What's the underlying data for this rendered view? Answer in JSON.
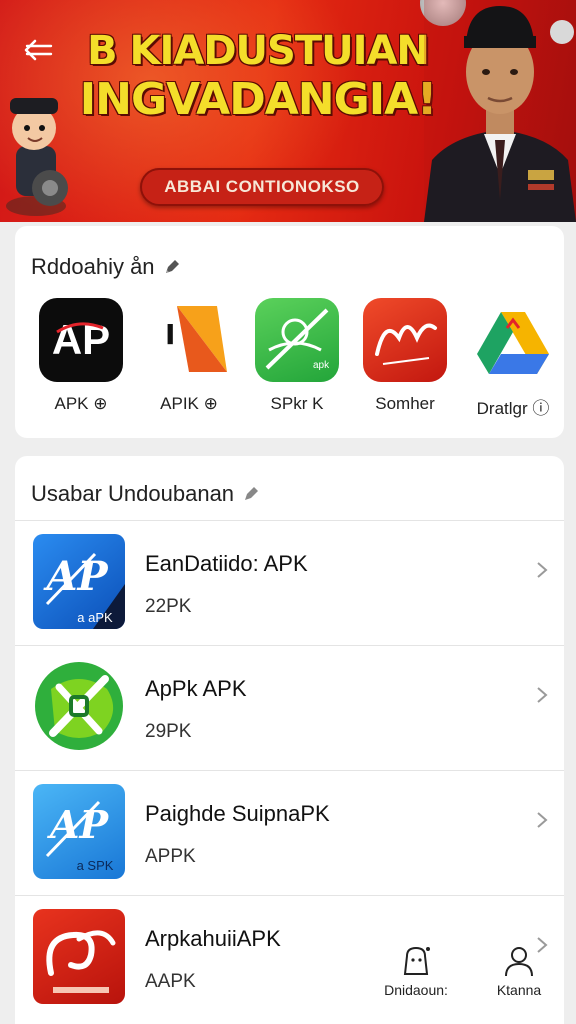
{
  "banner": {
    "headline_line1": "B KIADUSTUIAN",
    "headline_line2": "INGVADANGIA!",
    "pill_text": "ABBAI CONTIONOKSO",
    "colors": {
      "bg": "#d21818",
      "headline": "#f4de2a"
    }
  },
  "featured": {
    "title": "Rddoahiy ån",
    "apps": [
      {
        "label": "APK ⊕",
        "icon": "ap-letters-icon"
      },
      {
        "label": "APIK ⊕",
        "icon": "triangle-logo-icon"
      },
      {
        "label": "SPkr K",
        "icon": "green-apk-icon"
      },
      {
        "label": "Somher",
        "icon": "red-signature-icon"
      },
      {
        "label": "Dratlgr ⓘ",
        "icon": "drive-triangle-icon"
      }
    ]
  },
  "downloads": {
    "title": "Usabar Undoubanan",
    "items": [
      {
        "name": "EanDatiido: APK",
        "size": "22PK",
        "icon": "blue-ap-icon",
        "icon_caption": "a aPK"
      },
      {
        "name": "ApPk APK",
        "size": "29PK",
        "icon": "green-cross-icon",
        "icon_caption": ""
      },
      {
        "name": "Paighde SuipnaPK",
        "size": "APPK",
        "icon": "light-blue-ap-icon",
        "icon_caption": "a SPK"
      },
      {
        "name": "ArpkahuiiAPK",
        "size": "AAPK",
        "icon": "red-swirl-icon",
        "icon_caption": ""
      }
    ]
  },
  "bottom_nav": {
    "downloads_label": "Dnidaoun:",
    "account_label": "Ktanna"
  }
}
